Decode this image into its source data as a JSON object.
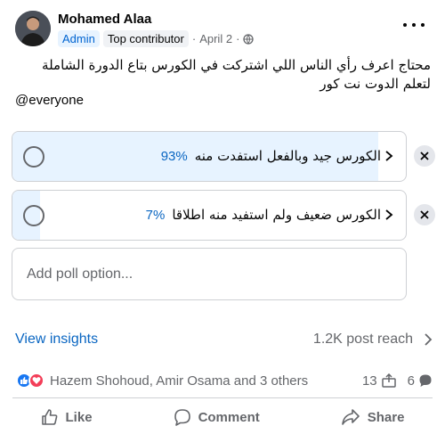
{
  "post": {
    "author": "Mohamed Alaa",
    "badges": [
      "Admin",
      "Top contributor"
    ],
    "date": "April 2",
    "text": "محتاج اعرف رأي الناس اللي اشتركت في الكورس بتاع الدورة الشاملة لتعلم الدوت نت كور",
    "mention": "@everyone"
  },
  "poll": {
    "options": [
      {
        "label": "الكورس جيد وبالفعل استفدت منه",
        "percent_text": "93%",
        "percent": 93
      },
      {
        "label": "الكورس ضعيف ولم استفيد منه اطلاقا",
        "percent_text": "7%",
        "percent": 7
      }
    ],
    "add_placeholder": "Add poll option..."
  },
  "insights": {
    "link": "View insights",
    "reach": "1.2K post reach"
  },
  "engagement": {
    "names": "Hazem Shohoud, Amir Osama and 3 others",
    "shares": "13",
    "comments": "6"
  },
  "actions": {
    "like": "Like",
    "comment": "Comment",
    "share": "Share"
  },
  "colors": {
    "accent": "#0a66c2",
    "fill": "#e7f3ff",
    "like": "#1877f2",
    "love": "#f33e58"
  }
}
